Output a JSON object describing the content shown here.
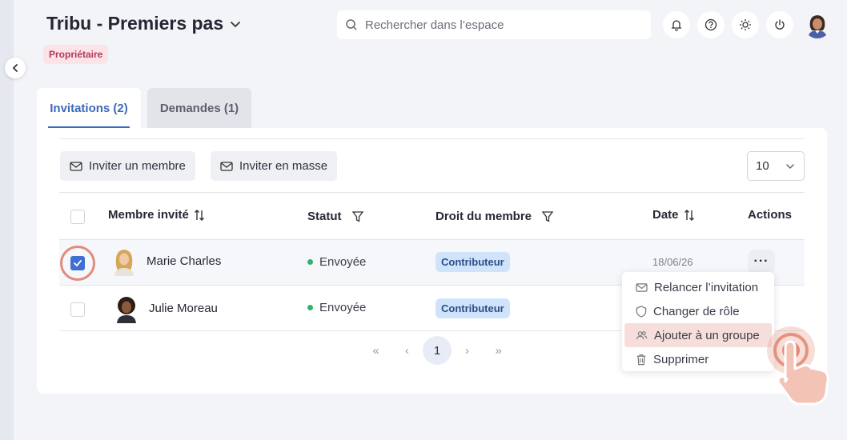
{
  "header": {
    "title": "Tribu - Premiers pas",
    "role_badge": "Propriétaire",
    "search_placeholder": "Rechercher dans l’espace",
    "icons": [
      "bell-icon",
      "help-icon",
      "sun-icon",
      "power-icon"
    ]
  },
  "tabs": [
    {
      "label": "Invitations (2)",
      "active": true
    },
    {
      "label": "Demandes (1)",
      "active": false
    }
  ],
  "toolbar": {
    "invite_member": "Inviter un membre",
    "invite_bulk": "Inviter en masse",
    "page_size": "10"
  },
  "table": {
    "columns": {
      "member": "Membre invité",
      "status": "Statut",
      "right": "Droit du membre",
      "date": "Date",
      "actions": "Actions"
    },
    "rows": [
      {
        "name": "Marie Charles",
        "status": "Envoyée",
        "right": "Contributeur",
        "date": "18/06/26",
        "selected": true
      },
      {
        "name": "Julie Moreau",
        "status": "Envoyée",
        "right": "Contributeur",
        "date": "",
        "selected": false
      }
    ],
    "actions_button": "···"
  },
  "pagination": {
    "first": "«",
    "prev": "‹",
    "current": "1",
    "next": "›",
    "last": "»"
  },
  "context_menu": {
    "items": [
      {
        "label": "Relancer l’invitation",
        "icon": "mail-icon"
      },
      {
        "label": "Changer de rôle",
        "icon": "shield-icon"
      },
      {
        "label": "Ajouter à un groupe",
        "icon": "group-icon",
        "hovered": true
      },
      {
        "label": "Supprimer",
        "icon": "trash-icon"
      }
    ]
  },
  "colors": {
    "accent": "#3a6ab8",
    "badge_bg": "#fbe3e8",
    "badge_text": "#b23a57",
    "pill_bg": "#cfe4fb",
    "status_dot": "#2fb36b",
    "menu_hover": "#f6dfdb",
    "focus_ring": "#e08b7c"
  }
}
